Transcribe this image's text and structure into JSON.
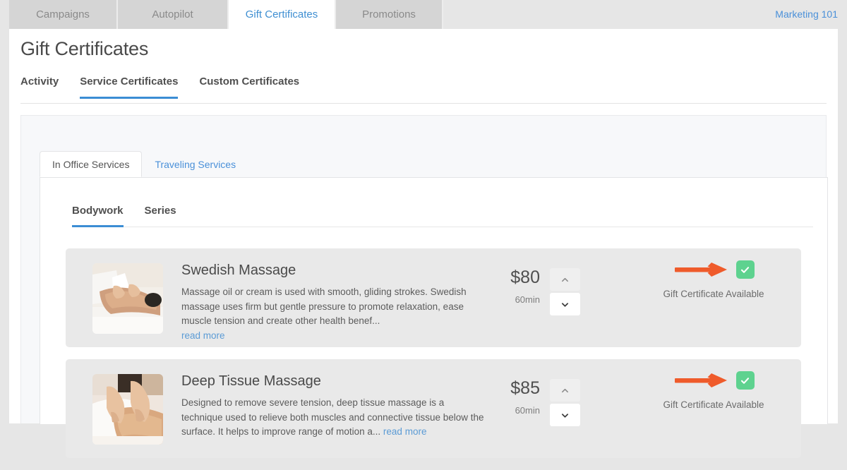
{
  "topbar": {
    "tabs": [
      {
        "label": "Campaigns",
        "active": false
      },
      {
        "label": "Autopilot",
        "active": false
      },
      {
        "label": "Gift Certificates",
        "active": true
      },
      {
        "label": "Promotions",
        "active": false
      }
    ],
    "marketing_link": "Marketing 101"
  },
  "page": {
    "title": "Gift Certificates",
    "subtabs": [
      {
        "label": "Activity"
      },
      {
        "label": "Service Certificates"
      },
      {
        "label": "Custom Certificates"
      }
    ],
    "active_subtab": "Service Certificates"
  },
  "panel": {
    "tabs": [
      {
        "label": "In Office Services"
      },
      {
        "label": "Traveling Services"
      }
    ],
    "active_tab": "In Office Services",
    "inner_tabs": [
      {
        "label": "Bodywork"
      },
      {
        "label": "Series"
      }
    ],
    "active_inner_tab": "Bodywork"
  },
  "services": [
    {
      "title": "Swedish Massage",
      "description": "Massage oil or cream is used with smooth, gliding strokes. Swedish massage uses firm but gentle pressure to promote relaxation, ease muscle tension and create other health benef...",
      "read_more": "read more",
      "read_more_inline": false,
      "price": "$80",
      "duration": "60min",
      "stepper_up_icon": "chevron-up-icon",
      "stepper_down_icon": "chevron-down-icon",
      "gift_certificate_label": "Gift Certificate Available",
      "gift_certificate_checked": true,
      "annotation_arrow": "arrow-right-icon",
      "thumbnail_alt": "swedish-massage-photo"
    },
    {
      "title": "Deep Tissue Massage",
      "description": "Designed to remove severe tension, deep tissue massage is a technique used to relieve both muscles and connective tissue below the surface. It helps to improve range of motion a...",
      "read_more": "read more",
      "read_more_inline": true,
      "price": "$85",
      "duration": "60min",
      "stepper_up_icon": "chevron-up-icon",
      "stepper_down_icon": "chevron-down-icon",
      "gift_certificate_label": "Gift Certificate Available",
      "gift_certificate_checked": true,
      "annotation_arrow": "arrow-right-icon",
      "thumbnail_alt": "deep-tissue-massage-photo"
    }
  ],
  "colors": {
    "accent_blue": "#3b8dd4",
    "link_blue": "#4a90d9",
    "check_green": "#5ed28f",
    "annotation_orange": "#ef5b2b",
    "card_grey": "#e9e9e9"
  }
}
